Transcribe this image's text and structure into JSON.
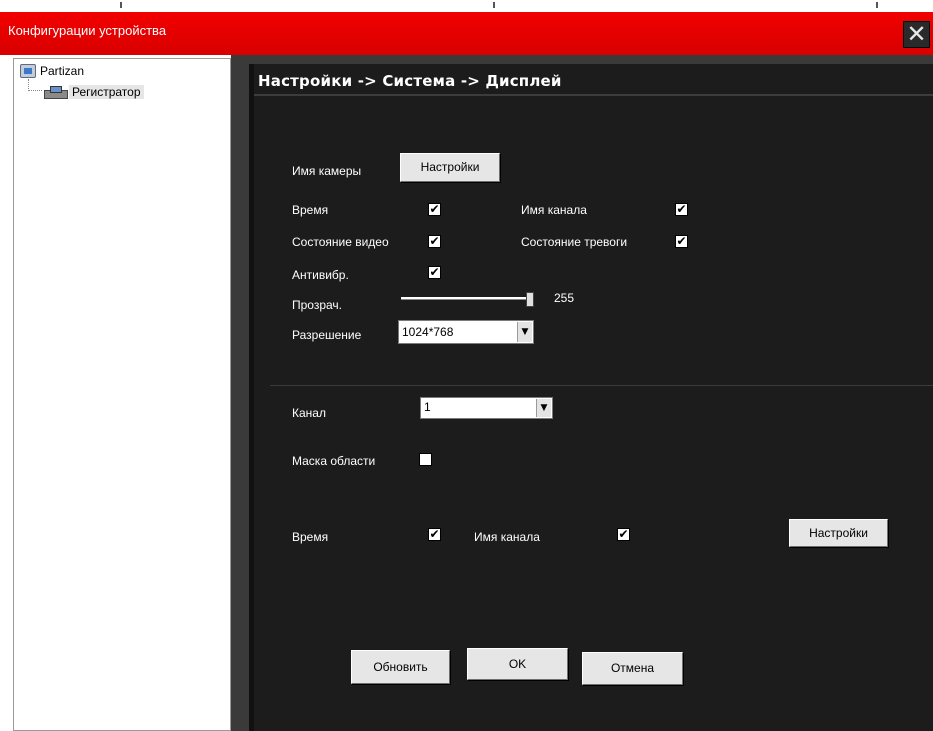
{
  "window": {
    "title": "Конфигурации устройства",
    "close_glyph": "✕"
  },
  "tree": {
    "root_label": "Partizan",
    "child_label": "Регистратор",
    "root_icon": "network-icon",
    "child_icon": "dvr-device-icon"
  },
  "breadcrumb": "Настройки -> Система -> Дисплей",
  "display": {
    "camera_name_label": "Имя камеры",
    "camera_settings_button": "Настройки",
    "time_label": "Время",
    "time_checked": true,
    "channel_name_label": "Имя канала",
    "channel_name_checked": true,
    "video_status_label": "Состояние видео",
    "video_status_checked": true,
    "alarm_status_label": "Состояние тревоги",
    "alarm_status_checked": true,
    "antishake_label": "Антивибр.",
    "antishake_checked": true,
    "transparency_label": "Прозрач.",
    "transparency_value": "255",
    "resolution_label": "Разрешение",
    "resolution_value": "1024*768"
  },
  "channel": {
    "channel_label": "Канал",
    "channel_value": "1",
    "mask_label": "Маска области",
    "mask_checked": false,
    "time_label": "Время",
    "time_checked": true,
    "channel_name_label": "Имя канала",
    "channel_name_checked": true,
    "settings_button": "Настройки"
  },
  "footer": {
    "refresh_button": "Обновить",
    "ok_button": "OK",
    "cancel_button": "Отмена"
  },
  "check_glyph": "✔",
  "dropdown_glyph": "▼",
  "colors": {
    "titlebar": "#e00000",
    "panel_bg": "#1c1c1c",
    "outer_bg": "#3a3a3a",
    "text": "#ffffff"
  }
}
